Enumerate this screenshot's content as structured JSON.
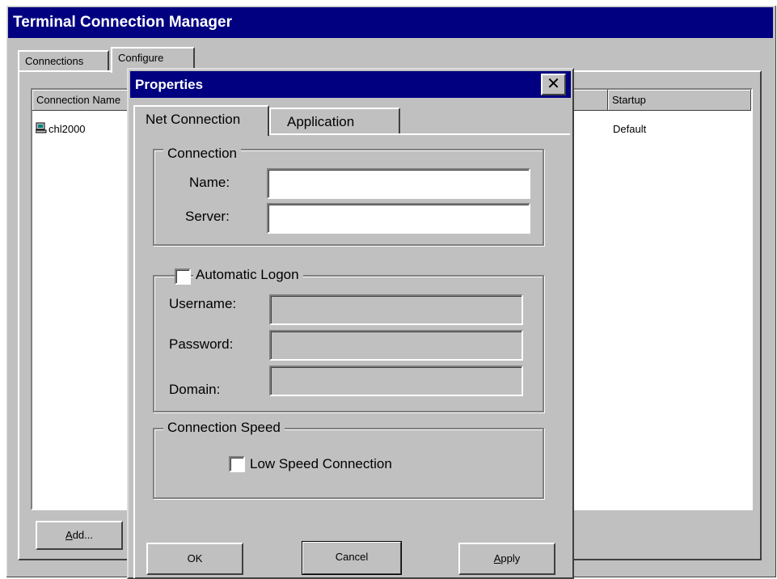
{
  "main_window": {
    "title": "Terminal Connection Manager",
    "tabs": [
      {
        "label": "Connections"
      },
      {
        "label": "Configure"
      }
    ],
    "list": {
      "columns": [
        "Connection Name",
        "",
        "Startup"
      ],
      "rows": [
        {
          "name": "chl2000",
          "startup": "Default",
          "icon": "computer-icon"
        }
      ]
    },
    "buttons": {
      "add_prefix": "",
      "add_accel": "A",
      "add_rest": "dd..."
    }
  },
  "properties_dialog": {
    "title": "Properties",
    "close_glyph": "✕",
    "tabs": [
      {
        "label": "Net Connection",
        "selected": true
      },
      {
        "label": "Application",
        "selected": false
      }
    ],
    "connection_group": {
      "legend": "Connection",
      "name_label": "Name:",
      "name_value": "",
      "server_label": "Server:",
      "server_value": ""
    },
    "logon_group": {
      "legend": "Automatic Logon",
      "checked": false,
      "username_label": "Username:",
      "password_label": "Password:",
      "domain_label": "Domain:"
    },
    "speed_group": {
      "legend": "Connection Speed",
      "low_speed_label": "Low Speed Connection",
      "low_speed_checked": false
    },
    "buttons": {
      "ok": "OK",
      "cancel": "Cancel",
      "apply_accel": "A",
      "apply_rest": "pply"
    }
  },
  "colors": {
    "titlebar": "#000080",
    "face": "#c0c0c0",
    "window_bg": "#ffffff"
  }
}
